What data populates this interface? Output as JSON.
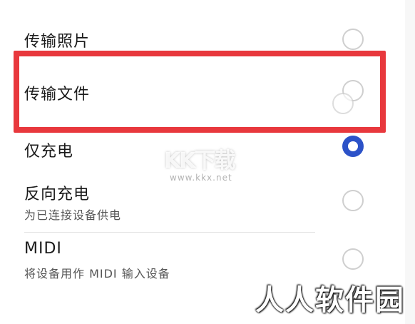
{
  "options": [
    {
      "title": "传输照片",
      "subtitle": "",
      "checked": false
    },
    {
      "title": "传输文件",
      "subtitle": "",
      "checked": false
    },
    {
      "title": "仅充电",
      "subtitle": "",
      "checked": true
    },
    {
      "title": "反向充电",
      "subtitle": "为已连接设备供电",
      "checked": false
    },
    {
      "title": "MIDI",
      "subtitle": "将设备用作 MIDI 输入设备",
      "checked": false
    }
  ],
  "watermarks": {
    "logo": "KK下载",
    "url": "www.kkx.net",
    "site": "人人软件园"
  },
  "colors": {
    "highlight": "#e8383d",
    "accent": "#2c52c8"
  }
}
